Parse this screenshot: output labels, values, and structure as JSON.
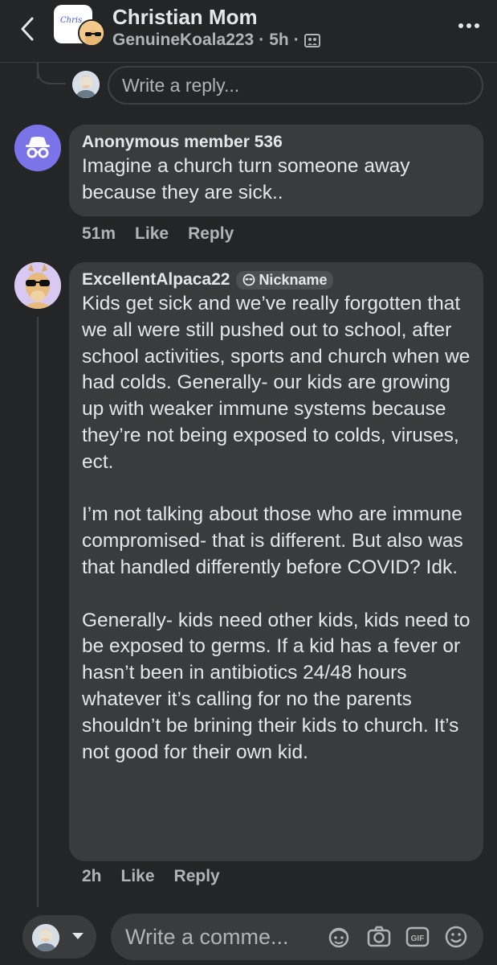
{
  "header": {
    "title": "Christian Mom",
    "author": "GenuineKoala223",
    "sep1": "·",
    "time": "5h",
    "sep2": "·",
    "logo_text": "Chris",
    "icons": [
      "back-icon",
      "group-avatar",
      "privacy-group-icon",
      "more-icon"
    ]
  },
  "reply_box": {
    "placeholder": "Write a reply..."
  },
  "comments": [
    {
      "author": "Anonymous member 536",
      "avatar": "incognito-icon",
      "avatar_color": "#7b73e8",
      "text": "Imagine a church turn someone away because they are sick..",
      "time": "51m",
      "like": "Like",
      "reply": "Reply"
    },
    {
      "author": "ExcellentAlpaca22",
      "badge": "Nickname",
      "avatar": "alpaca-sunglasses-avatar",
      "avatar_color": "#d9c9f2",
      "text": "Kids get sick and we’ve really forgotten that we all were still pushed out to school, after school activities, sports and church when we had colds. Generally- our kids are growing up with weaker immune systems because they’re not being exposed to colds, viruses, ect.\n\nI’m not talking about those who are immune compromised- that is different. But also was that handled differently before COVID? Idk.\n\nGenerally- kids need other kids, kids need to be exposed to germs.  If a kid has a fever or hasn’t been in antibiotics 24/48 hours whatever it’s calling for no the parents shouldn’t be brining their kids to church. It’s not good for their own kid.",
      "time": "2h",
      "like": "Like",
      "reply": "Reply"
    }
  ],
  "composer": {
    "placeholder": "Write a comme...",
    "icons": [
      "avatar-sticker-icon",
      "camera-icon",
      "gif-icon",
      "emoji-icon"
    ]
  },
  "colors": {
    "background": "#242526",
    "bubble": "#3a3b3c",
    "text": "#e4e6eb",
    "secondary": "#b0b3b8",
    "anon_avatar": "#7b73e8"
  }
}
